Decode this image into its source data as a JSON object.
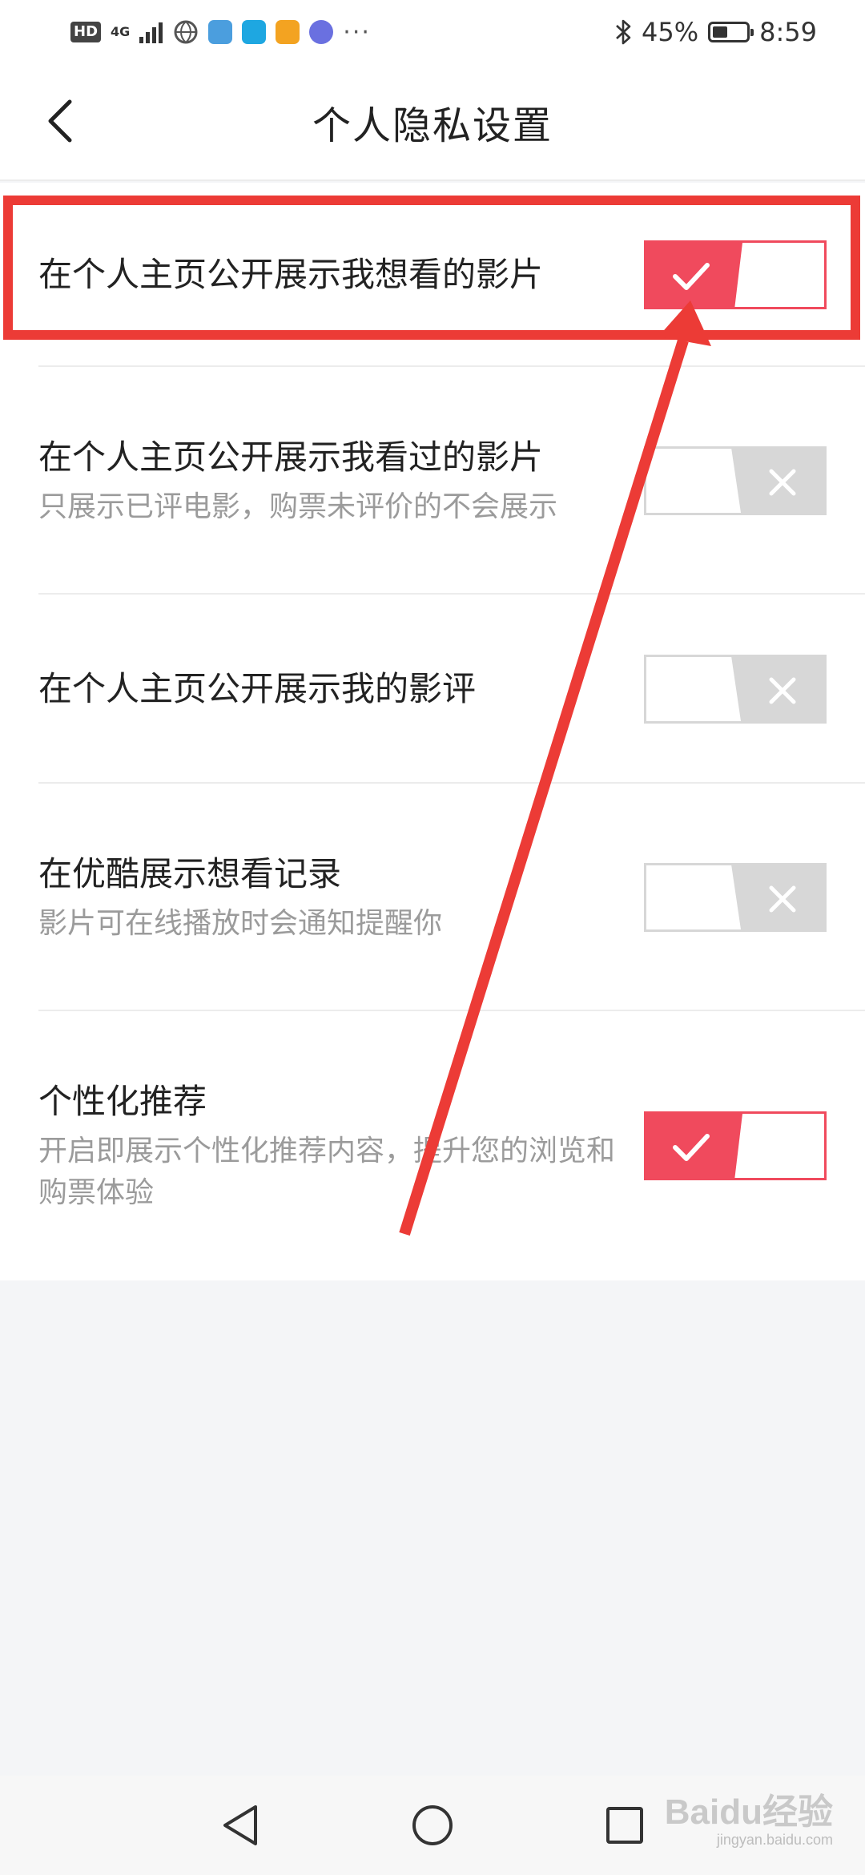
{
  "status_bar": {
    "badge": "HD",
    "network": "4G",
    "more": "···",
    "battery_percent": "45%",
    "battery_level": 0.45,
    "time": "8:59",
    "app_icon_colors": [
      "#4b9ede",
      "#1ea7e1",
      "#f3a321",
      "#6a70e0"
    ]
  },
  "header": {
    "title": "个人隐私设置"
  },
  "colors": {
    "accent": "#f04a5d",
    "annotation": "#ec3b36",
    "toggle_off": "#d7d7d7"
  },
  "settings": [
    {
      "title": "在个人主页公开展示我想看的影片",
      "subtitle": "",
      "enabled": true
    },
    {
      "title": "在个人主页公开展示我看过的影片",
      "subtitle": "只展示已评电影，购票未评价的不会展示",
      "enabled": false
    },
    {
      "title": "在个人主页公开展示我的影评",
      "subtitle": "",
      "enabled": false
    },
    {
      "title": "在优酷展示想看记录",
      "subtitle": "影片可在线播放时会通知提醒你",
      "enabled": false
    },
    {
      "title": "个性化推荐",
      "subtitle": "开启即展示个性化推荐内容，提升您的浏览和购票体验",
      "enabled": true
    }
  ],
  "watermark": {
    "text": "Baidu经验",
    "sub": "jingyan.baidu.com"
  }
}
